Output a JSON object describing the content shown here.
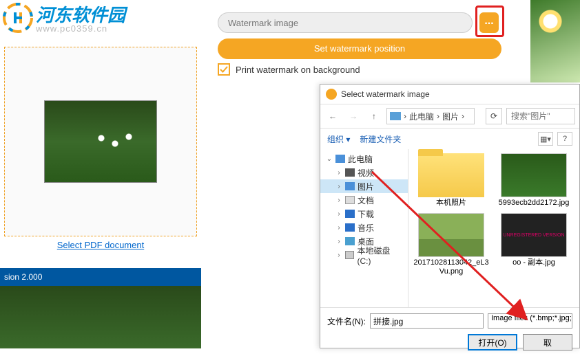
{
  "logo": {
    "text": "河东软件园",
    "url": "www.pc0359.cn"
  },
  "pdf": {
    "select_link": "Select PDF document"
  },
  "version_bar": "sion 2.000",
  "watermark": {
    "input_placeholder": "Watermark image",
    "browse_label": "...",
    "set_position": "Set watermark position",
    "print_bg": "Print watermark on background"
  },
  "dialog": {
    "title": "Select watermark image",
    "nav": {
      "path_root": "此电脑",
      "path_sep": "›",
      "path_folder": "图片",
      "search_placeholder": "搜索\"图片\""
    },
    "toolbar": {
      "organize": "组织 ▾",
      "newfolder": "新建文件夹"
    },
    "tree": {
      "thispc": "此电脑",
      "video": "视频",
      "pictures": "图片",
      "docs": "文档",
      "downloads": "下载",
      "music": "音乐",
      "desktop": "桌面",
      "disk_c": "本地磁盘 (C:)"
    },
    "files": {
      "f0": "本机照片",
      "f1": "5993ecb2dd2172.jpg",
      "f2": "20171028113042_eL3Vu.png",
      "f3_thumb": "UNREGISTERED VERSION",
      "f3": "oo - 副本.jpg"
    },
    "bottom": {
      "filename_label": "文件名(N):",
      "filename_value": "拼接.jpg",
      "filter": "Image files (*.bmp;*.jpg;",
      "open": "打开(O)",
      "cancel": "取"
    }
  }
}
